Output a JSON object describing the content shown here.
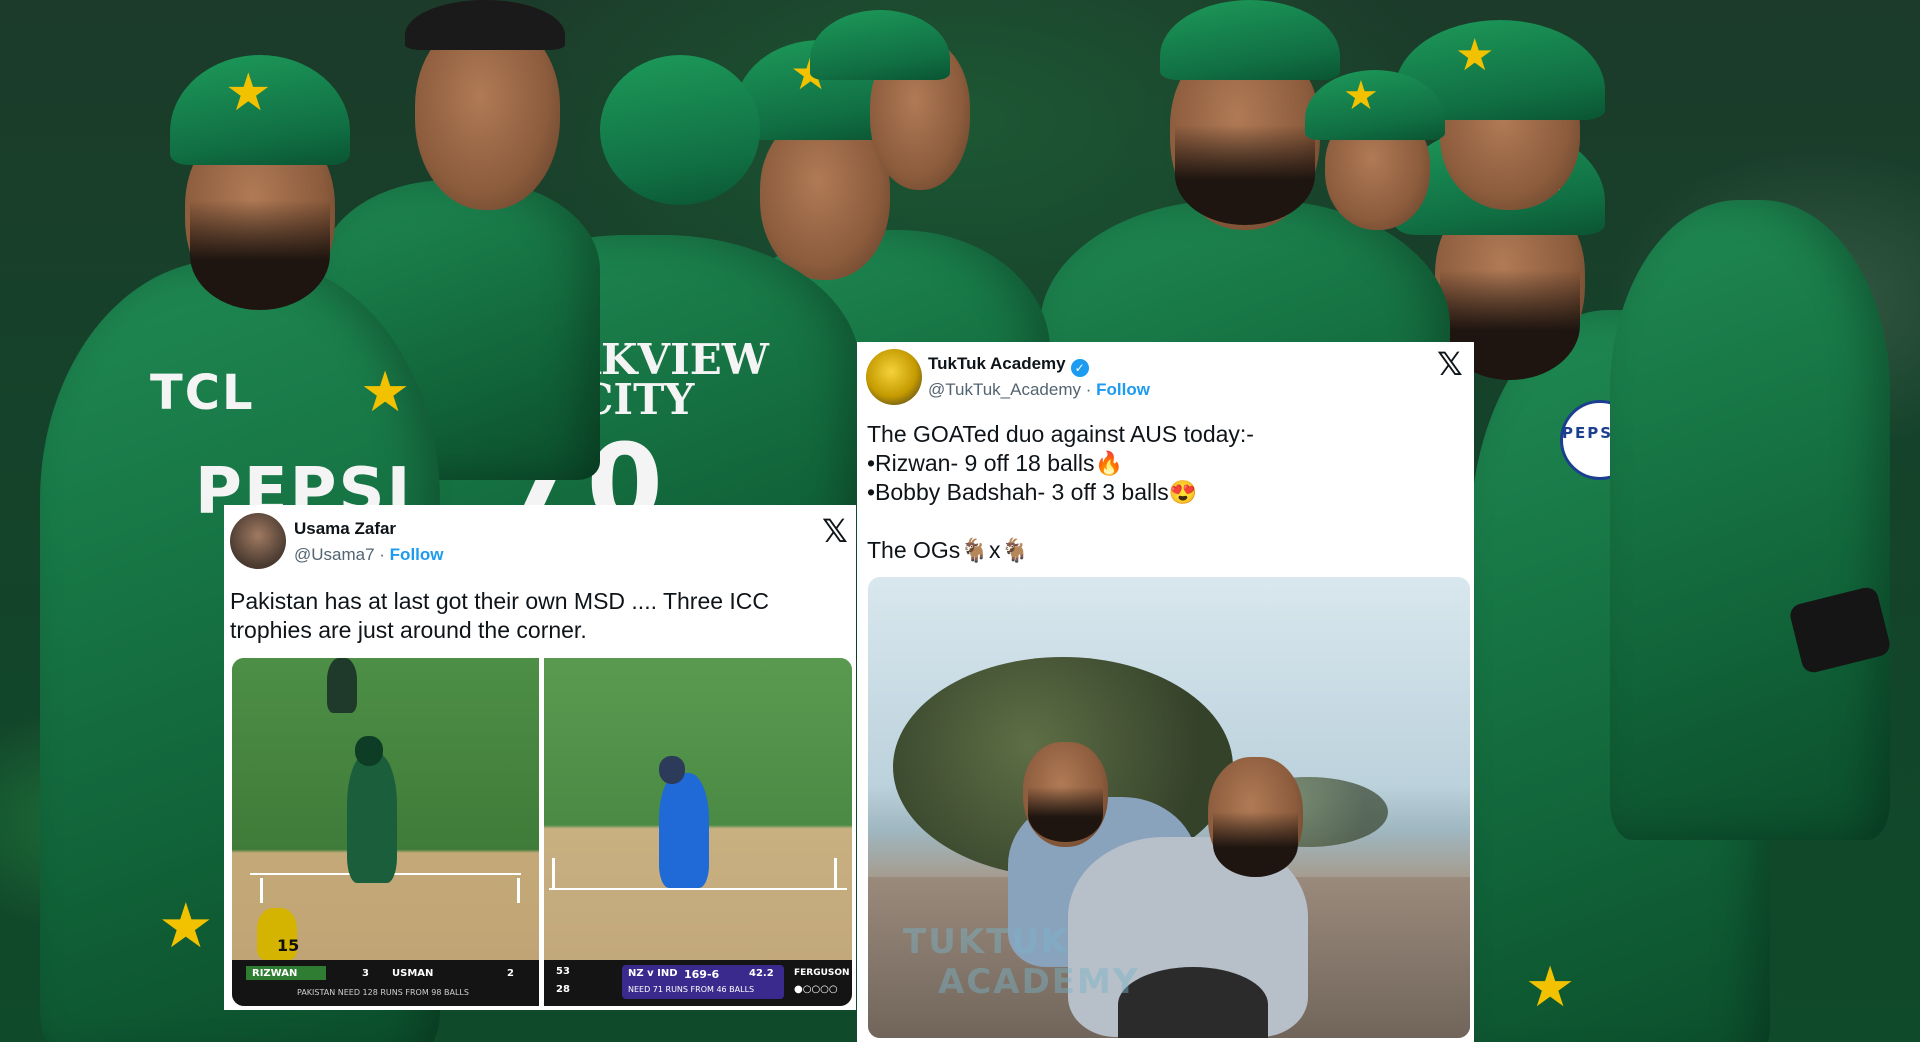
{
  "background": {
    "sponsors": {
      "tcl": "TCL",
      "pepsi": "PEPSI",
      "parkview_line1": "PARKVIEW",
      "parkview_line2": "CITY",
      "jersey_number": "70",
      "pepsi_logo": "PEPSI"
    },
    "colors": {
      "jersey": "#137a45",
      "cap_star": "#f2c200"
    }
  },
  "tweets": [
    {
      "name": "Usama Zafar",
      "handle": "@Usama7",
      "separator": " · ",
      "follow": "Follow",
      "text": "Pakistan has at last got their own MSD .... Three ICC\ntrophies are just around the corner.",
      "logo_icon": "x-logo-icon",
      "media": {
        "left_frame": {
          "batter1": "RIZWAN",
          "batter1_score": "3",
          "batter2": "USMAN",
          "batter2_score": "2",
          "target_text": "PAKISTAN NEED 128 RUNS FROM 98 BALLS",
          "player_number": "15"
        },
        "right_frame": {
          "line1_runs": "53",
          "line2_runs": "28",
          "teams": "NZ v IND",
          "score": "169-6",
          "overs": "42.2",
          "bowler": "FERGUSON",
          "target_text": "NEED 71 RUNS FROM 46 BALLS"
        }
      }
    },
    {
      "name": "TukTuk Academy",
      "verified": true,
      "handle": "@TukTuk_Academy",
      "separator": " · ",
      "follow": "Follow",
      "text": "The GOATed duo against AUS today:-\n•Rizwan- 9 off 18 balls🔥\n•Bobby Badshah- 3 off 3 balls😍\n\nThe OGs🐐x🐐",
      "logo_icon": "x-logo-icon",
      "media": {
        "watermark_line1": "TUKTUK",
        "watermark_line2": "ACADEMY"
      }
    }
  ]
}
